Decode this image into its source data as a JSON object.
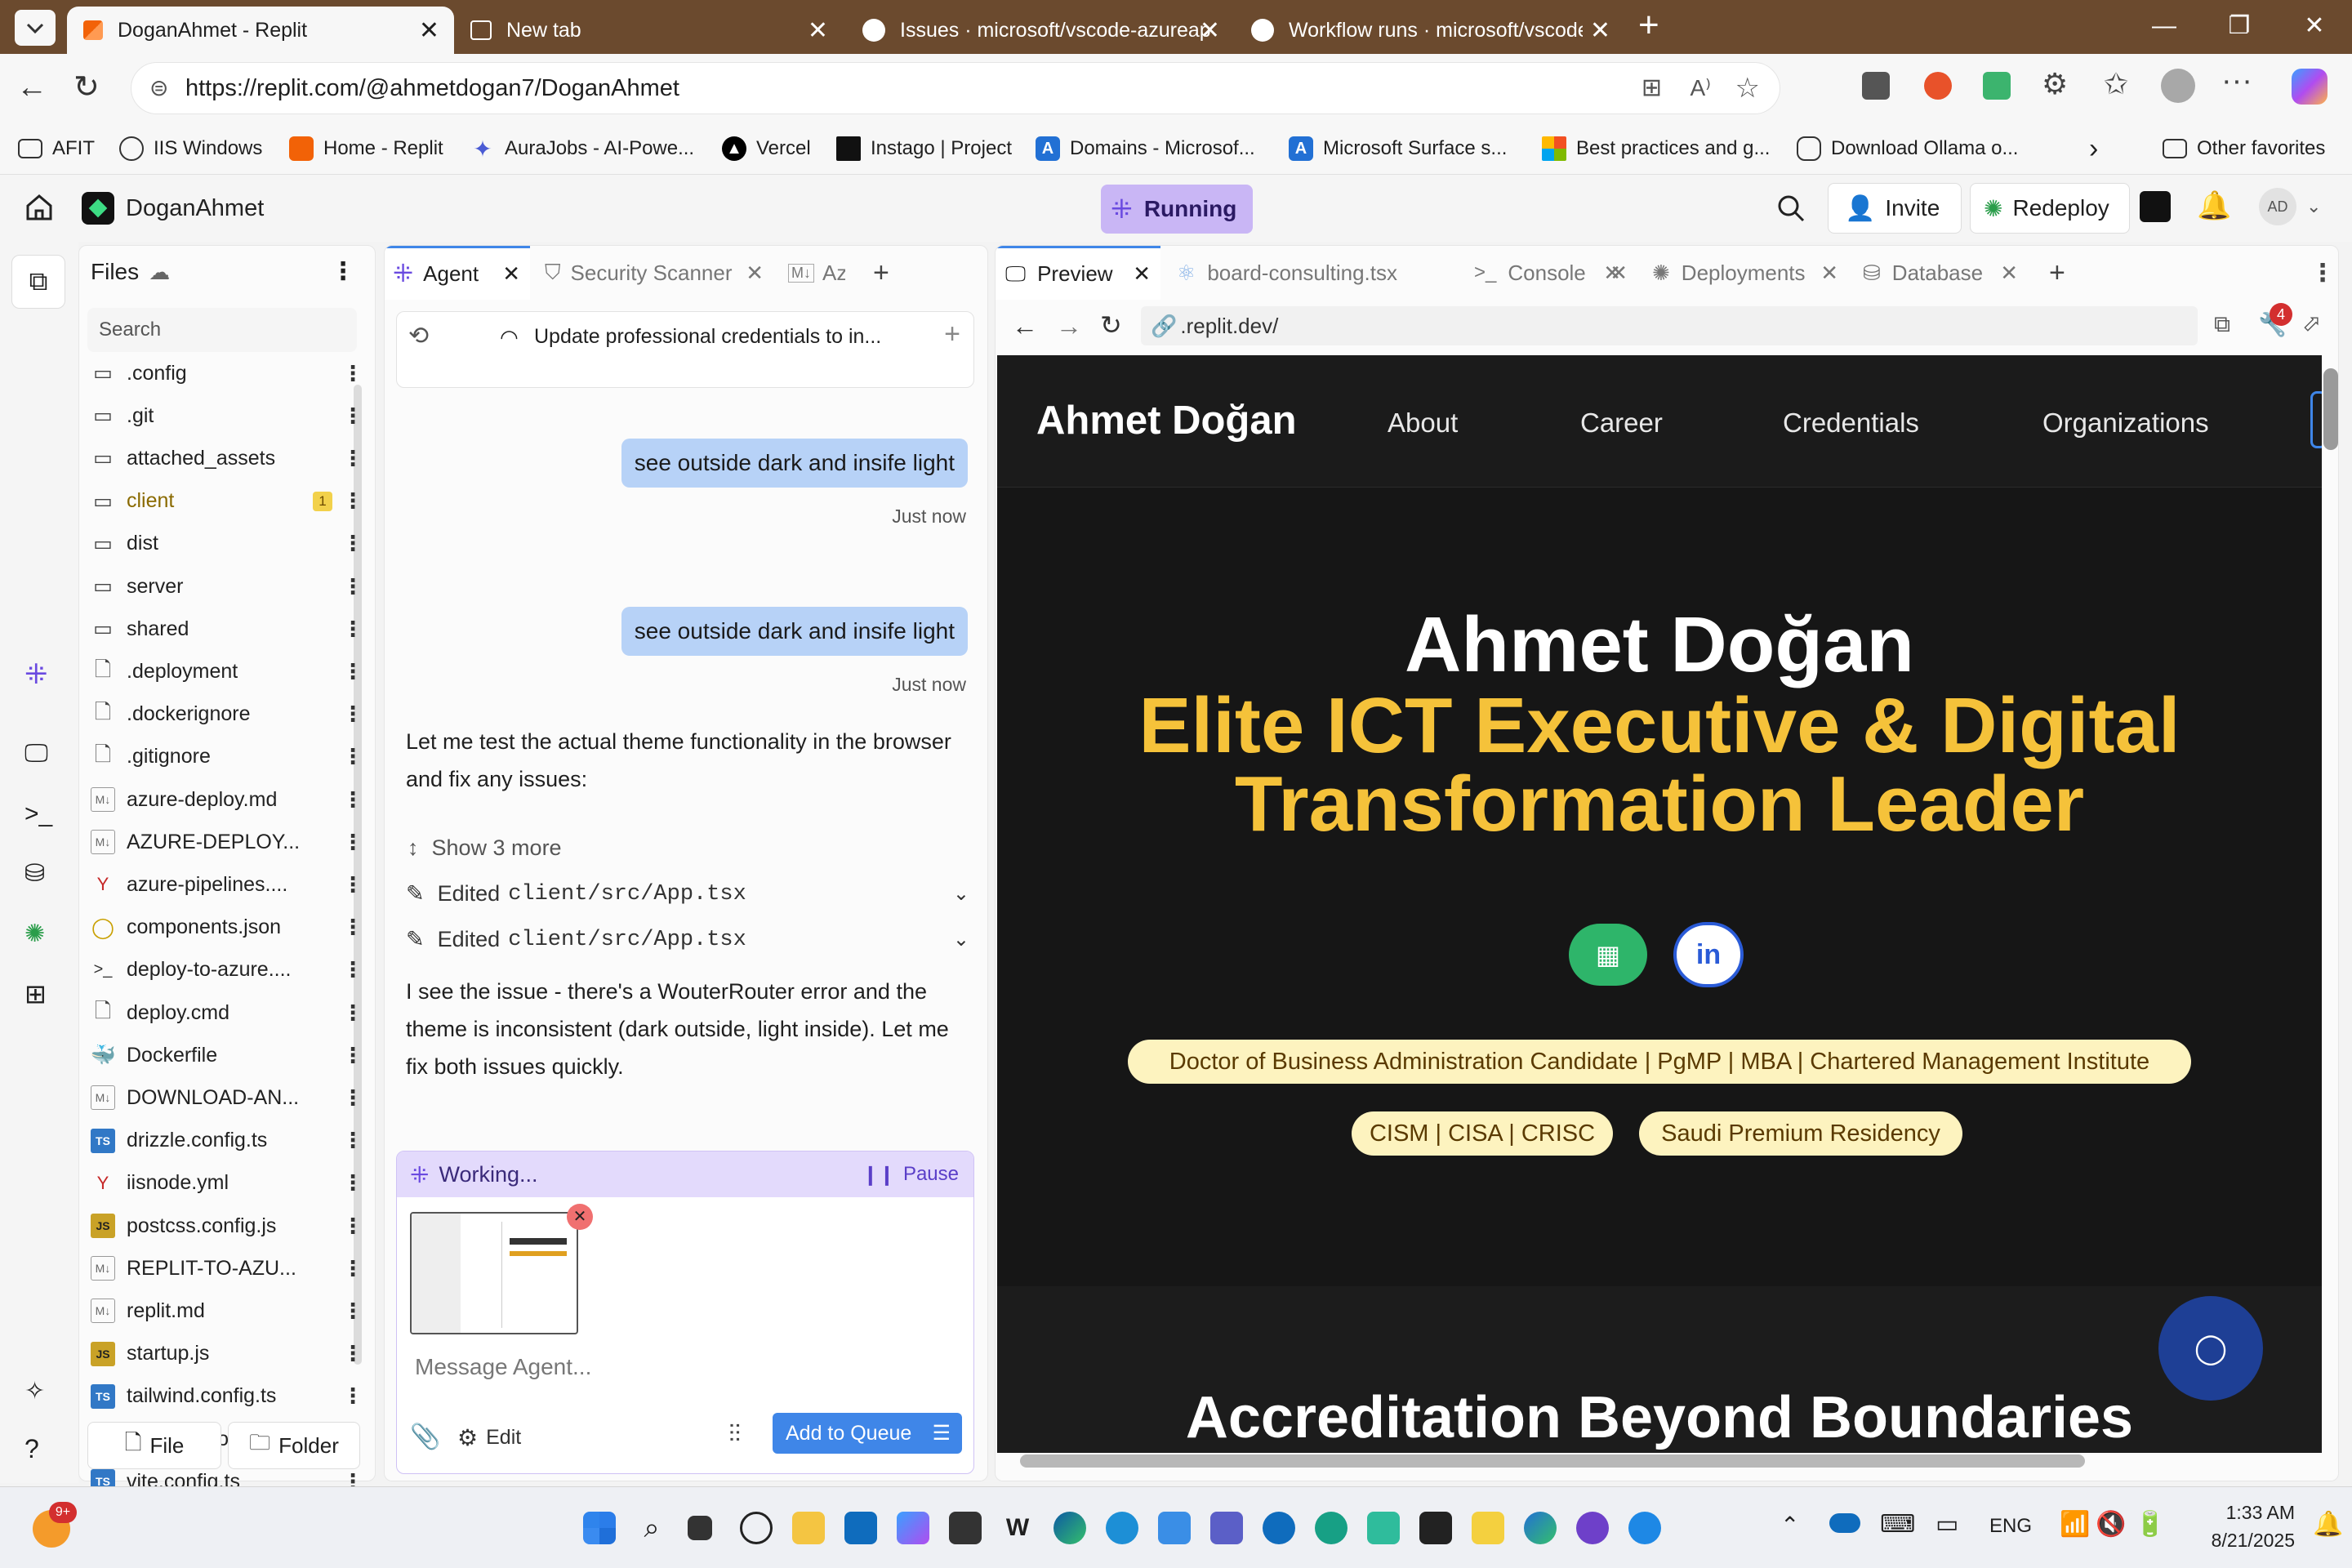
{
  "browser": {
    "tabs": [
      {
        "title": "DoganAhmet - Replit",
        "active": true
      },
      {
        "title": "New tab",
        "active": false
      },
      {
        "title": "Issues · microsoft/vscode-azureap",
        "active": false
      },
      {
        "title": "Workflow runs · microsoft/vscode",
        "active": false
      }
    ],
    "url": "https://replit.com/@ahmetdogan7/DoganAhmet",
    "bookmarks": [
      "AFIT",
      "IIS Windows",
      "Home - Replit",
      "AuraJobs - AI-Powe...",
      "Vercel",
      "Instago | Project",
      "Domains - Microsof...",
      "Microsoft Surface s...",
      "Best practices and g...",
      "Download Ollama o..."
    ],
    "other_favorites": "Other favorites"
  },
  "replit": {
    "project_name": "DoganAhmet",
    "status": "Running",
    "invite": "Invite",
    "redeploy": "Redeploy",
    "avatar": "AD"
  },
  "files": {
    "title": "Files",
    "search_placeholder": "Search",
    "items": [
      {
        "name": ".config",
        "type": "folder"
      },
      {
        "name": ".git",
        "type": "folder"
      },
      {
        "name": "attached_assets",
        "type": "folder"
      },
      {
        "name": "client",
        "type": "folder",
        "badge": "1"
      },
      {
        "name": "dist",
        "type": "folder"
      },
      {
        "name": "server",
        "type": "folder"
      },
      {
        "name": "shared",
        "type": "folder"
      },
      {
        "name": ".deployment",
        "type": "file"
      },
      {
        "name": ".dockerignore",
        "type": "file"
      },
      {
        "name": ".gitignore",
        "type": "file"
      },
      {
        "name": "azure-deploy.md",
        "type": "md"
      },
      {
        "name": "AZURE-DEPLOY...",
        "type": "md"
      },
      {
        "name": "azure-pipelines....",
        "type": "yml"
      },
      {
        "name": "components.json",
        "type": "json"
      },
      {
        "name": "deploy-to-azure....",
        "type": "sh"
      },
      {
        "name": "deploy.cmd",
        "type": "file"
      },
      {
        "name": "Dockerfile",
        "type": "docker"
      },
      {
        "name": "DOWNLOAD-AN...",
        "type": "md"
      },
      {
        "name": "drizzle.config.ts",
        "type": "ts"
      },
      {
        "name": "iisnode.yml",
        "type": "yml"
      },
      {
        "name": "postcss.config.js",
        "type": "js"
      },
      {
        "name": "REPLIT-TO-AZU...",
        "type": "md"
      },
      {
        "name": "replit.md",
        "type": "md"
      },
      {
        "name": "startup.js",
        "type": "js"
      },
      {
        "name": "tailwind.config.ts",
        "type": "ts"
      },
      {
        "name": "tsconfig.json",
        "type": "json"
      },
      {
        "name": "vite.config.ts",
        "type": "ts"
      }
    ],
    "new_file": "File",
    "new_folder": "Folder"
  },
  "agent": {
    "tabs": [
      "Agent",
      "Security Scanner",
      "Az"
    ],
    "thread_title": "Update professional credentials to in...",
    "messages": [
      {
        "text": "see outside dark and insife light",
        "time": "Just now"
      },
      {
        "text": "see outside dark and insife light",
        "time": "Just now"
      }
    ],
    "reply1": "Let me test the actual theme functionality in the browser and fix any issues:",
    "show_more": "Show 3 more",
    "edits": [
      {
        "prefix": "Edited",
        "path": "client/src/App.tsx"
      },
      {
        "prefix": "Edited",
        "path": "client/src/App.tsx"
      }
    ],
    "reply2": "I see the issue - there's a WouterRouter error and the theme is inconsistent (dark outside, light inside). Let me fix both issues quickly.",
    "working": "Working...",
    "pause": "Pause",
    "input_placeholder": "Message Agent...",
    "edit_label": "Edit",
    "queue_button": "Add to Queue"
  },
  "preview": {
    "tabs": [
      "Preview",
      "board-consulting.tsx",
      "Console",
      "Deployments",
      "Database"
    ],
    "url": ".replit.dev/",
    "badge_count": "4",
    "site": {
      "brand": "Ahmet Doğan",
      "nav": [
        "About",
        "Career",
        "Credentials",
        "Organizations"
      ],
      "hero_name": "Ahmet Doğan",
      "hero_title_line1": "Elite ICT Executive & Digital",
      "hero_title_line2": "Transformation Leader",
      "credentials": "Doctor of Business Administration Candidate | PgMP | MBA | Chartered Management Institute",
      "certs": "CISM | CISA | CRISC",
      "residency": "Saudi Premium Residency",
      "section_heading": "Accreditation Beyond Boundaries"
    }
  },
  "taskbar": {
    "notification_badge": "9+",
    "language": "ENG",
    "time": "1:33 AM",
    "date": "8/21/2025"
  },
  "colors": {
    "tabstrip": "#6b4a2e",
    "accent_blue": "#3f86e8",
    "hero_yellow": "#f5c23a",
    "running_purple": "#c9b6f5"
  }
}
